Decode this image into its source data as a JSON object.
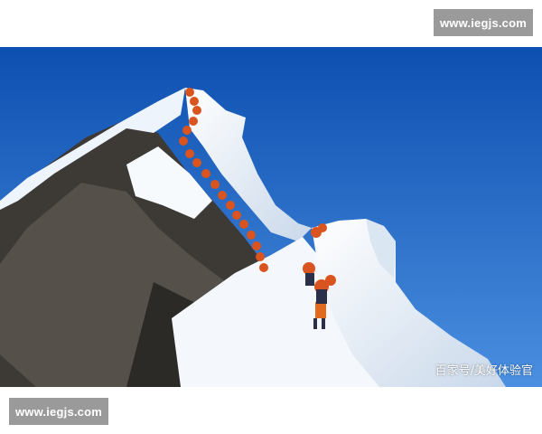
{
  "watermark": {
    "top_text": "www.iegjs.com",
    "bottom_text": "www.iegjs.com"
  },
  "photo": {
    "subject": "Climbers queueing on a snowy mountain ridge under a clear blue sky",
    "caption": "百家号/美好体验官",
    "colors": {
      "sky_top": "#0d4fb0",
      "sky_bottom": "#4a8fe0",
      "snow": "#f4f8fc",
      "rock": "#3d3a36",
      "climber": "#d9541e"
    }
  }
}
